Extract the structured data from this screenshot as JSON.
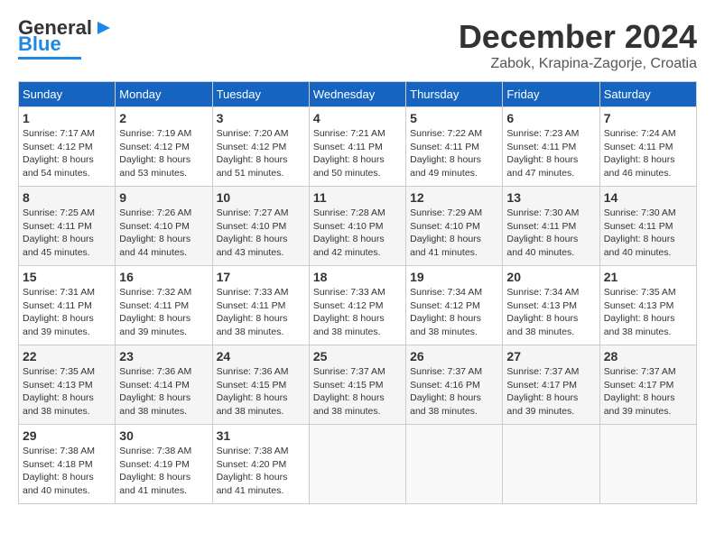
{
  "header": {
    "logo_general": "General",
    "logo_blue": "Blue",
    "month_title": "December 2024",
    "location": "Zabok, Krapina-Zagorje, Croatia"
  },
  "days_of_week": [
    "Sunday",
    "Monday",
    "Tuesday",
    "Wednesday",
    "Thursday",
    "Friday",
    "Saturday"
  ],
  "weeks": [
    [
      {
        "day": "1",
        "sunrise": "7:17 AM",
        "sunset": "4:12 PM",
        "daylight": "8 hours and 54 minutes."
      },
      {
        "day": "2",
        "sunrise": "7:19 AM",
        "sunset": "4:12 PM",
        "daylight": "8 hours and 53 minutes."
      },
      {
        "day": "3",
        "sunrise": "7:20 AM",
        "sunset": "4:12 PM",
        "daylight": "8 hours and 51 minutes."
      },
      {
        "day": "4",
        "sunrise": "7:21 AM",
        "sunset": "4:11 PM",
        "daylight": "8 hours and 50 minutes."
      },
      {
        "day": "5",
        "sunrise": "7:22 AM",
        "sunset": "4:11 PM",
        "daylight": "8 hours and 49 minutes."
      },
      {
        "day": "6",
        "sunrise": "7:23 AM",
        "sunset": "4:11 PM",
        "daylight": "8 hours and 47 minutes."
      },
      {
        "day": "7",
        "sunrise": "7:24 AM",
        "sunset": "4:11 PM",
        "daylight": "8 hours and 46 minutes."
      }
    ],
    [
      {
        "day": "8",
        "sunrise": "7:25 AM",
        "sunset": "4:11 PM",
        "daylight": "8 hours and 45 minutes."
      },
      {
        "day": "9",
        "sunrise": "7:26 AM",
        "sunset": "4:10 PM",
        "daylight": "8 hours and 44 minutes."
      },
      {
        "day": "10",
        "sunrise": "7:27 AM",
        "sunset": "4:10 PM",
        "daylight": "8 hours and 43 minutes."
      },
      {
        "day": "11",
        "sunrise": "7:28 AM",
        "sunset": "4:10 PM",
        "daylight": "8 hours and 42 minutes."
      },
      {
        "day": "12",
        "sunrise": "7:29 AM",
        "sunset": "4:10 PM",
        "daylight": "8 hours and 41 minutes."
      },
      {
        "day": "13",
        "sunrise": "7:30 AM",
        "sunset": "4:11 PM",
        "daylight": "8 hours and 40 minutes."
      },
      {
        "day": "14",
        "sunrise": "7:30 AM",
        "sunset": "4:11 PM",
        "daylight": "8 hours and 40 minutes."
      }
    ],
    [
      {
        "day": "15",
        "sunrise": "7:31 AM",
        "sunset": "4:11 PM",
        "daylight": "8 hours and 39 minutes."
      },
      {
        "day": "16",
        "sunrise": "7:32 AM",
        "sunset": "4:11 PM",
        "daylight": "8 hours and 39 minutes."
      },
      {
        "day": "17",
        "sunrise": "7:33 AM",
        "sunset": "4:11 PM",
        "daylight": "8 hours and 38 minutes."
      },
      {
        "day": "18",
        "sunrise": "7:33 AM",
        "sunset": "4:12 PM",
        "daylight": "8 hours and 38 minutes."
      },
      {
        "day": "19",
        "sunrise": "7:34 AM",
        "sunset": "4:12 PM",
        "daylight": "8 hours and 38 minutes."
      },
      {
        "day": "20",
        "sunrise": "7:34 AM",
        "sunset": "4:13 PM",
        "daylight": "8 hours and 38 minutes."
      },
      {
        "day": "21",
        "sunrise": "7:35 AM",
        "sunset": "4:13 PM",
        "daylight": "8 hours and 38 minutes."
      }
    ],
    [
      {
        "day": "22",
        "sunrise": "7:35 AM",
        "sunset": "4:13 PM",
        "daylight": "8 hours and 38 minutes."
      },
      {
        "day": "23",
        "sunrise": "7:36 AM",
        "sunset": "4:14 PM",
        "daylight": "8 hours and 38 minutes."
      },
      {
        "day": "24",
        "sunrise": "7:36 AM",
        "sunset": "4:15 PM",
        "daylight": "8 hours and 38 minutes."
      },
      {
        "day": "25",
        "sunrise": "7:37 AM",
        "sunset": "4:15 PM",
        "daylight": "8 hours and 38 minutes."
      },
      {
        "day": "26",
        "sunrise": "7:37 AM",
        "sunset": "4:16 PM",
        "daylight": "8 hours and 38 minutes."
      },
      {
        "day": "27",
        "sunrise": "7:37 AM",
        "sunset": "4:17 PM",
        "daylight": "8 hours and 39 minutes."
      },
      {
        "day": "28",
        "sunrise": "7:37 AM",
        "sunset": "4:17 PM",
        "daylight": "8 hours and 39 minutes."
      }
    ],
    [
      {
        "day": "29",
        "sunrise": "7:38 AM",
        "sunset": "4:18 PM",
        "daylight": "8 hours and 40 minutes."
      },
      {
        "day": "30",
        "sunrise": "7:38 AM",
        "sunset": "4:19 PM",
        "daylight": "8 hours and 41 minutes."
      },
      {
        "day": "31",
        "sunrise": "7:38 AM",
        "sunset": "4:20 PM",
        "daylight": "8 hours and 41 minutes."
      },
      null,
      null,
      null,
      null
    ]
  ],
  "labels": {
    "sunrise": "Sunrise:",
    "sunset": "Sunset:",
    "daylight": "Daylight:"
  }
}
